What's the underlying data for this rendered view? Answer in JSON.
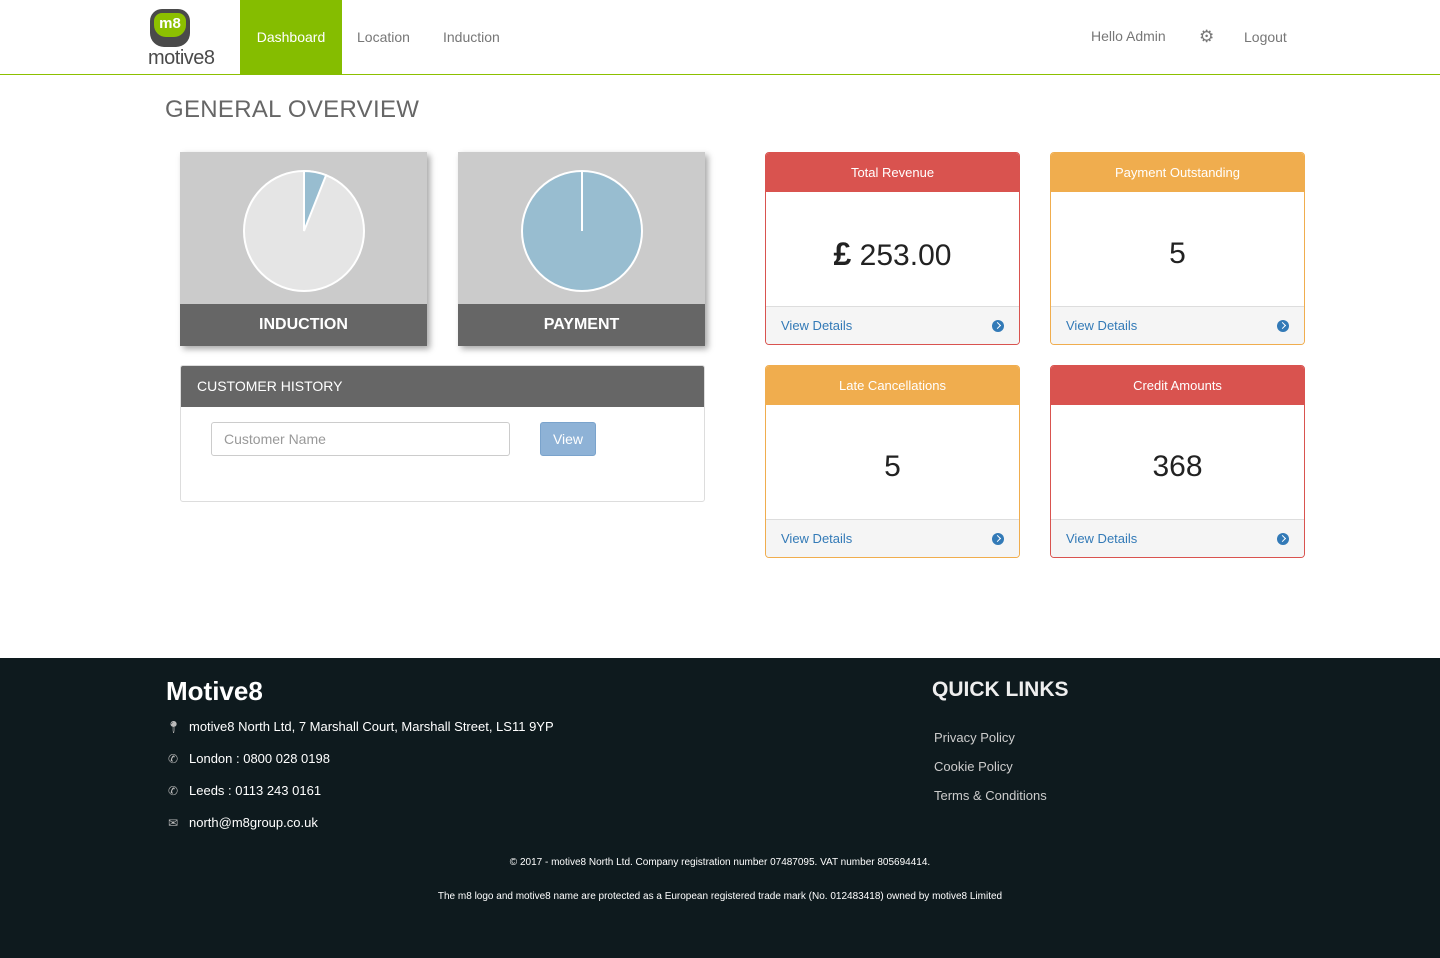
{
  "nav": {
    "logo_badge": "m8",
    "logo_word": "motive8",
    "items": [
      {
        "label": "Dashboard",
        "active": true
      },
      {
        "label": "Location"
      },
      {
        "label": "Induction"
      }
    ],
    "greeting": "Hello Admin",
    "settings_icon": "gear-icon",
    "logout": "Logout",
    "accent_color": "#85bd00"
  },
  "page": {
    "title": "GENERAL OVERVIEW"
  },
  "pies": {
    "induction": {
      "label": "INDUCTION",
      "slice_fraction": 0.06,
      "slice_color": "#98bdd0",
      "base_color": "#e5e5e5"
    },
    "payment": {
      "label": "PAYMENT",
      "slice_fraction": 1.0,
      "slice_color": "#98bdd0",
      "base_color": "#e5e5e5"
    }
  },
  "history": {
    "title": "CUSTOMER HISTORY",
    "placeholder": "Customer Name",
    "button": "View"
  },
  "stats": {
    "revenue": {
      "title": "Total Revenue",
      "currency": "£",
      "value": " 253.00",
      "link": "View Details",
      "color": "#d9534f"
    },
    "outstanding": {
      "title": "Payment Outstanding",
      "value": "5",
      "link": "View Details",
      "color": "#f0ad4e"
    },
    "late": {
      "title": "Late Cancellations",
      "value": "5",
      "link": "View Details",
      "color": "#f0ad4e"
    },
    "credit": {
      "title": "Credit Amounts",
      "value": "368",
      "link": "View Details",
      "color": "#d9534f"
    }
  },
  "footer": {
    "brand": "Motive8",
    "address": "motive8 North Ltd, 7 Marshall Court, Marshall Street, LS11 9YP",
    "london": "London : 0800 028 0198",
    "leeds": "Leeds : 0113 243 0161",
    "email": "north@m8group.co.uk",
    "quick_links_title": "QUICK LINKS",
    "links": [
      "Privacy Policy",
      "Cookie Policy",
      "Terms & Conditions"
    ],
    "copyright": "© 2017 - motive8 North Ltd. Company registration number 07487095. VAT number 805694414.",
    "trademark": "The m8 logo and motive8 name are protected as a European registered trade mark (No. 012483418) owned by motive8 Limited"
  }
}
